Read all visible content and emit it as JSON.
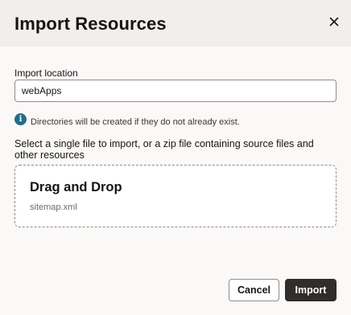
{
  "dialog": {
    "title": "Import Resources",
    "close_icon": "close-icon"
  },
  "import_location": {
    "label": "Import location",
    "value": "webApps"
  },
  "info": {
    "icon": "info-icon",
    "glyph": "i",
    "text": "Directories will be created if they do not already exist."
  },
  "instructions": "Select a single file to import, or a zip file containing source files and other resources",
  "dropzone": {
    "title": "Drag and Drop",
    "file_name": "sitemap.xml"
  },
  "footer": {
    "cancel_label": "Cancel",
    "import_label": "Import"
  },
  "colors": {
    "header_bg": "#f1efed",
    "primary_button": "#312d2a",
    "info_icon": "#1f6e8c"
  }
}
